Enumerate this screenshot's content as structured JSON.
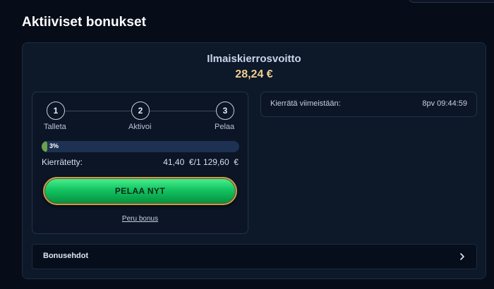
{
  "page": {
    "title": "Aktiiviset bonukset"
  },
  "offer": {
    "title": "Ilmaiskierrosvoitto",
    "amount": "28,24 €"
  },
  "steps": [
    {
      "number": "1",
      "label": "Talleta"
    },
    {
      "number": "2",
      "label": "Aktivoi"
    },
    {
      "number": "3",
      "label": "Pelaa"
    }
  ],
  "progress": {
    "percent": 3,
    "text": "3%"
  },
  "wager": {
    "label": "Kierrätetty:",
    "value": "41,40  €/1 129,60  €"
  },
  "play_button": {
    "label": "PELAA NYT"
  },
  "cancel_link": {
    "label": "Peru bonus"
  },
  "deadline": {
    "label": "Kierrätä viimeistään:",
    "value": "8pv 09:44:59"
  },
  "terms": {
    "label": "Bonusehdot",
    "icon": "chevron-right-icon"
  },
  "colors": {
    "background": "#060c18",
    "card": "#0d1829",
    "accent_gold": "#f0cf90",
    "button_green": "#14c462",
    "progress_fill": "#6aa14d"
  }
}
